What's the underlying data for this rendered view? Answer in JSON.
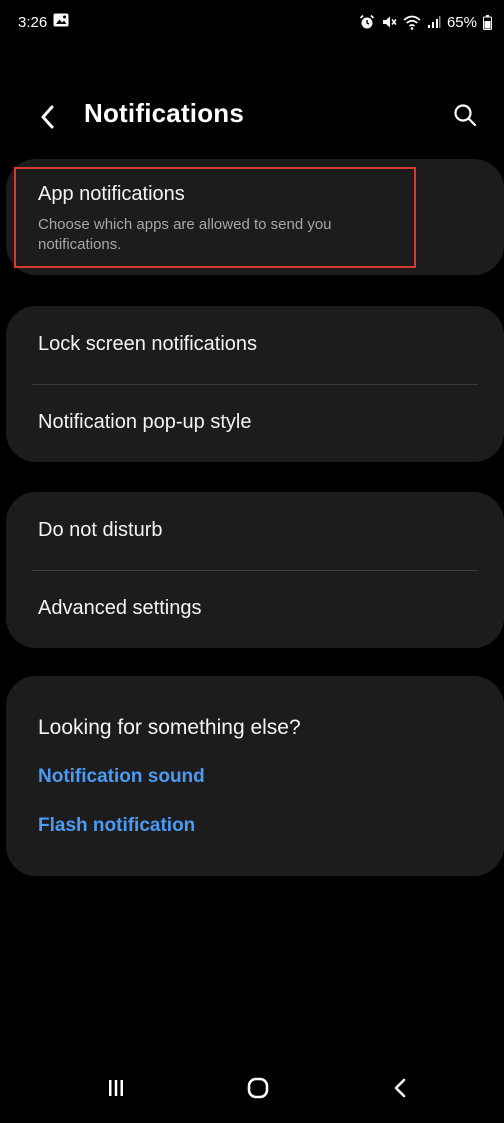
{
  "status_bar": {
    "time": "3:26",
    "battery": "65%",
    "icons": [
      "image-icon",
      "alarm-icon",
      "mute-icon",
      "wifi-icon",
      "signal-icon",
      "battery-icon"
    ]
  },
  "header": {
    "title": "Notifications",
    "back_icon": "chevron-left-icon",
    "search_icon": "search-icon"
  },
  "sections": {
    "app_notifications": {
      "title": "App notifications",
      "subtitle": "Choose which apps are allowed to send you notifications."
    },
    "lock_screen": {
      "title": "Lock screen notifications"
    },
    "popup_style": {
      "title": "Notification pop-up style"
    },
    "do_not_disturb": {
      "title": "Do not disturb"
    },
    "advanced": {
      "title": "Advanced settings"
    },
    "looking_for": {
      "heading": "Looking for something else?",
      "links": [
        "Notification sound",
        "Flash notification"
      ]
    }
  },
  "nav_bar": {
    "icons": [
      "recent-apps-icon",
      "home-icon",
      "back-icon"
    ]
  },
  "colors": {
    "background": "#000000",
    "card": "#1c1c1c",
    "link": "#4a9bf5",
    "highlight": "#d63b2f"
  }
}
